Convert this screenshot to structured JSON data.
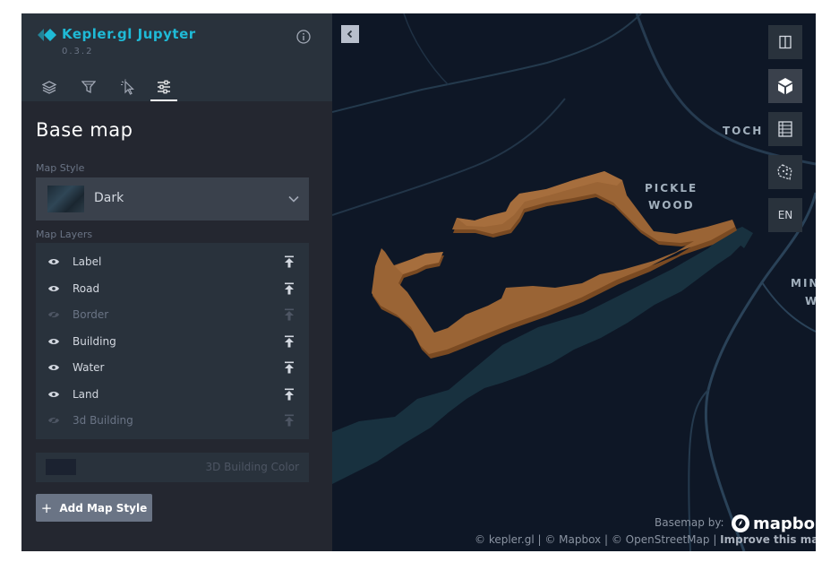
{
  "header": {
    "app_title": "Kepler.gl Jupyter",
    "version": "0.3.2"
  },
  "tabs": [
    {
      "name": "layers-icon",
      "active": false
    },
    {
      "name": "filter-icon",
      "active": false
    },
    {
      "name": "interaction-icon",
      "active": false
    },
    {
      "name": "map-settings-icon",
      "active": true
    }
  ],
  "panel": {
    "title": "Base map",
    "map_style_label": "Map Style",
    "map_style_value": "Dark",
    "map_layers_label": "Map Layers",
    "layers": [
      {
        "label": "Label",
        "visible": true
      },
      {
        "label": "Road",
        "visible": true
      },
      {
        "label": "Border",
        "visible": false
      },
      {
        "label": "Building",
        "visible": true
      },
      {
        "label": "Water",
        "visible": true
      },
      {
        "label": "Land",
        "visible": true
      },
      {
        "label": "3d Building",
        "visible": false
      }
    ],
    "building_color_label": "3D Building Color",
    "add_style_label": "Add Map Style"
  },
  "map": {
    "places": [
      "TOCH W",
      "PICKLE",
      "WOOD",
      "MIN",
      "W"
    ],
    "language": "EN",
    "basemap_by": "Basemap by:",
    "mapbox_logo": "mapbo",
    "attribution": {
      "kepler": "© kepler.gl",
      "mapbox": "© Mapbox",
      "osm": "© OpenStreetMap",
      "improve": "Improve this map"
    },
    "controls": [
      "split-map-icon",
      "3d-map-icon",
      "legend-icon",
      "draw-polygon-icon"
    ]
  },
  "colors": {
    "accent": "#1fbad6",
    "panel_bg": "#242730",
    "map_bg": "#0e1726",
    "water": "#18313f",
    "extrusion": "#9a6435"
  }
}
